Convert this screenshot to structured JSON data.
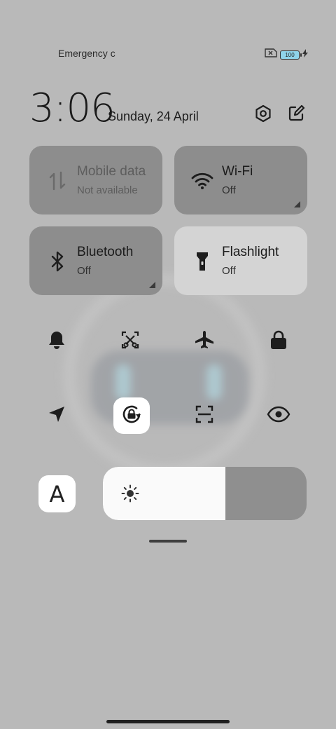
{
  "status_bar": {
    "carrier_text": "Emergency c",
    "battery_level": "100",
    "icons": [
      "no-sim-icon",
      "battery-icon",
      "charging-icon"
    ]
  },
  "header": {
    "time": "3:06",
    "date": "Sunday, 24 April",
    "buttons": [
      "settings-icon",
      "edit-icon"
    ]
  },
  "tiles": [
    {
      "name": "Mobile data",
      "state": "Not available",
      "icon": "mobile-data-icon",
      "enabled": false
    },
    {
      "name": "Wi-Fi",
      "state": "Off",
      "icon": "wifi-icon",
      "enabled": true
    },
    {
      "name": "Bluetooth",
      "state": "Off",
      "icon": "bluetooth-icon",
      "enabled": true
    },
    {
      "name": "Flashlight",
      "state": "Off",
      "icon": "flashlight-icon",
      "enabled": true
    }
  ],
  "toggles": [
    {
      "icon": "bell-icon",
      "active": false
    },
    {
      "icon": "screenshot-icon",
      "active": false
    },
    {
      "icon": "airplane-icon",
      "active": false
    },
    {
      "icon": "lock-icon",
      "active": false
    },
    {
      "icon": "location-icon",
      "active": false
    },
    {
      "icon": "rotation-lock-icon",
      "active": true
    },
    {
      "icon": "scanner-icon",
      "active": false
    },
    {
      "icon": "eye-icon",
      "active": false
    }
  ],
  "brightness": {
    "auto_label": "A",
    "level": 0.6,
    "icon": "sun-icon"
  },
  "colors": {
    "background": "#b9b9b9",
    "tile_off": "#8d8d8d",
    "tile_light": "#d4d4d4",
    "active": "#ffffff",
    "battery_fill": "#8fd3ea"
  }
}
